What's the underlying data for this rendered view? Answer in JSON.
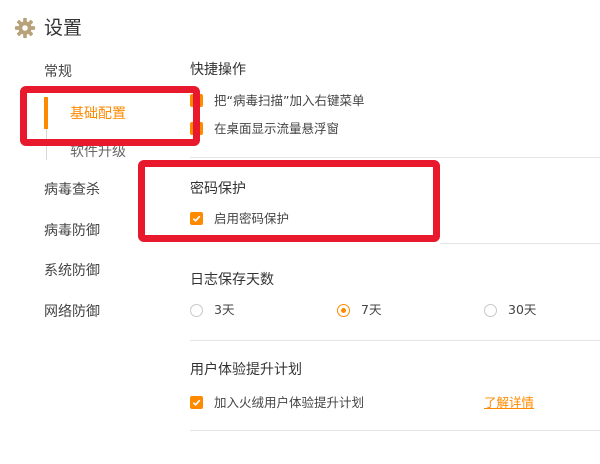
{
  "header": {
    "title": "设置",
    "icon": "gear-icon"
  },
  "sidebar": {
    "items": [
      {
        "label": "常规"
      },
      {
        "label": "基础配置",
        "active": true
      },
      {
        "label": "软件升级"
      },
      {
        "label": "病毒查杀"
      },
      {
        "label": "病毒防御"
      },
      {
        "label": "系统防御"
      },
      {
        "label": "网络防御"
      }
    ]
  },
  "sections": {
    "shortcuts": {
      "title": "快捷操作",
      "options": [
        {
          "label": "把“病毒扫描”加入右键菜单",
          "checked": true
        },
        {
          "label": "在桌面显示流量悬浮窗",
          "checked": true
        }
      ]
    },
    "password": {
      "title": "密码保护",
      "option": {
        "label": "启用密码保护",
        "checked": true
      }
    },
    "log": {
      "title": "日志保存天数",
      "options": [
        {
          "label": "3天",
          "selected": false
        },
        {
          "label": "7天",
          "selected": true
        },
        {
          "label": "30天",
          "selected": false
        }
      ]
    },
    "ux": {
      "title": "用户体验提升计划",
      "option": {
        "label": "加入火绒用户体验提升计划",
        "checked": true
      },
      "link": "了解详情"
    }
  },
  "colors": {
    "accent": "#ff8a00",
    "highlight": "#e8192c"
  }
}
